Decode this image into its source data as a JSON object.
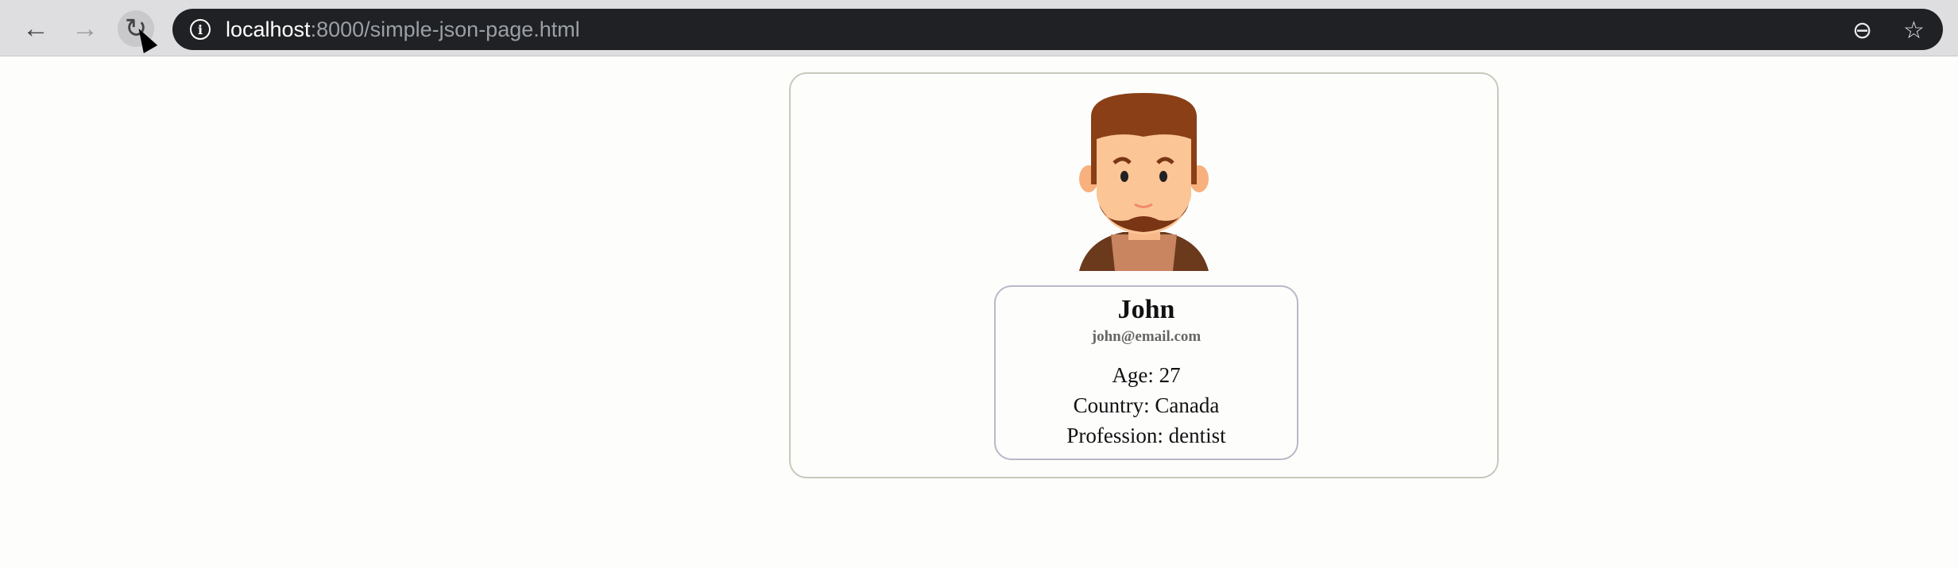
{
  "browser": {
    "url_host": "localhost",
    "url_rest": ":8000/simple-json-page.html",
    "icons": [
      "back-icon",
      "forward-icon",
      "reload-icon",
      "info-icon",
      "zoom-out-icon",
      "star-icon"
    ]
  },
  "profile": {
    "name": "John",
    "email": "john@email.com",
    "age": "Age: 27",
    "country": "Country: Canada",
    "profession": "Profession: dentist"
  }
}
